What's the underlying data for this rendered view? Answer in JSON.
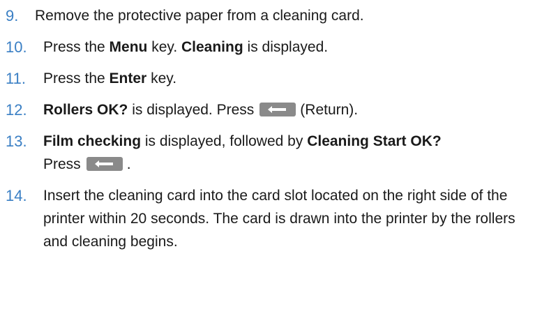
{
  "steps": [
    {
      "num": "9.",
      "parts": [
        "Remove the protective paper from a cleaning card."
      ]
    },
    {
      "num": "10.",
      "parts": [
        "Press the ",
        "Menu",
        " key. ",
        "Cleaning",
        " is displayed."
      ]
    },
    {
      "num": "11.",
      "parts": [
        "Press the ",
        "Enter",
        " key."
      ]
    },
    {
      "num": "12.",
      "parts": [
        "Rollers OK?",
        " is displayed. Press",
        "(Return)."
      ]
    },
    {
      "num": "13.",
      "parts": [
        "Film checking",
        " is displayed, followed by ",
        "Cleaning Start OK?",
        "Press",
        "."
      ]
    },
    {
      "num": "14.",
      "parts": [
        "Insert the cleaning card into the card slot located on the right side of the printer within 20 seconds. The card is drawn into the printer by the rollers and cleaning begins."
      ]
    }
  ],
  "icons": {
    "return_key": "return-key-icon",
    "key_color": "#8a8a8a",
    "number_color": "#3a7fc4"
  }
}
